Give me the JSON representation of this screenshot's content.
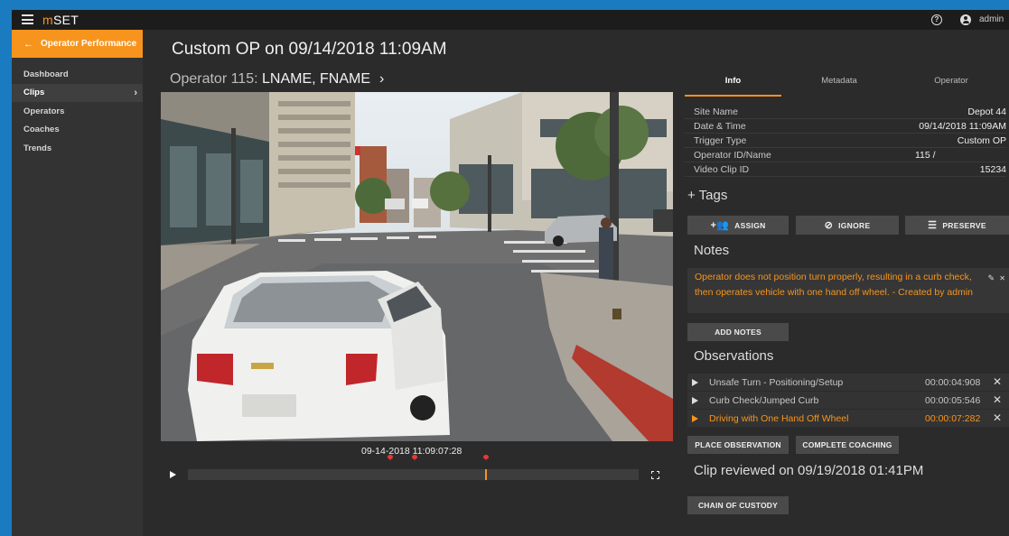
{
  "topbar": {
    "brand_m": "m",
    "brand_rest": "SET",
    "user": "admin"
  },
  "sidebar": {
    "section_button": "Operator Performance",
    "items": [
      {
        "label": "Dashboard",
        "active": false
      },
      {
        "label": "Clips",
        "active": true
      },
      {
        "label": "Operators",
        "active": false
      },
      {
        "label": "Coaches",
        "active": false
      },
      {
        "label": "Trends",
        "active": false
      }
    ]
  },
  "main": {
    "title": "Custom OP on 09/14/2018 11:09AM",
    "operator_prefix": "Operator 115: ",
    "operator_name": "LNAME, FNAME",
    "video_timestamp": "09-14-2018 11:09:07:28",
    "timeline_progress": 0.66,
    "markers": [
      0.44,
      0.5,
      0.66
    ]
  },
  "panel": {
    "tabs": [
      "Info",
      "Metadata",
      "Operator"
    ],
    "active_tab": "Info",
    "info": [
      {
        "key": "Site Name",
        "value": "Depot 44"
      },
      {
        "key": "Date & Time",
        "value": "09/14/2018 11:09AM"
      },
      {
        "key": "Trigger Type",
        "value": "Custom OP"
      },
      {
        "key": "Operator ID/Name",
        "value": "115 /"
      },
      {
        "key": "Video Clip ID",
        "value": "15234"
      }
    ],
    "tags_heading": "Tags",
    "tag_buttons": {
      "assign": "ASSIGN",
      "ignore": "IGNORE",
      "preserve": "PRESERVE"
    },
    "notes_heading": "Notes",
    "note_text": "Operator does not position turn properly, resulting in a curb check, then operates vehicle with one hand off wheel. - Created by admin",
    "add_notes": "ADD NOTES",
    "observations_heading": "Observations",
    "observations": [
      {
        "name": "Unsafe Turn - Positioning/Setup",
        "time": "00:00:04:908",
        "active": false
      },
      {
        "name": "Curb Check/Jumped Curb",
        "time": "00:00:05:546",
        "active": false
      },
      {
        "name": "Driving with One Hand Off Wheel",
        "time": "00:00:07:282",
        "active": true
      }
    ],
    "place_observation": "PLACE OBSERVATION",
    "complete_coaching": "COMPLETE COACHING",
    "reviewed": "Clip reviewed on 09/19/2018 01:41PM",
    "chain_of_custody": "CHAIN OF CUSTODY"
  },
  "colors": {
    "accent": "#f7941d",
    "marker": "#e53935",
    "frame": "#1a7bc0"
  }
}
